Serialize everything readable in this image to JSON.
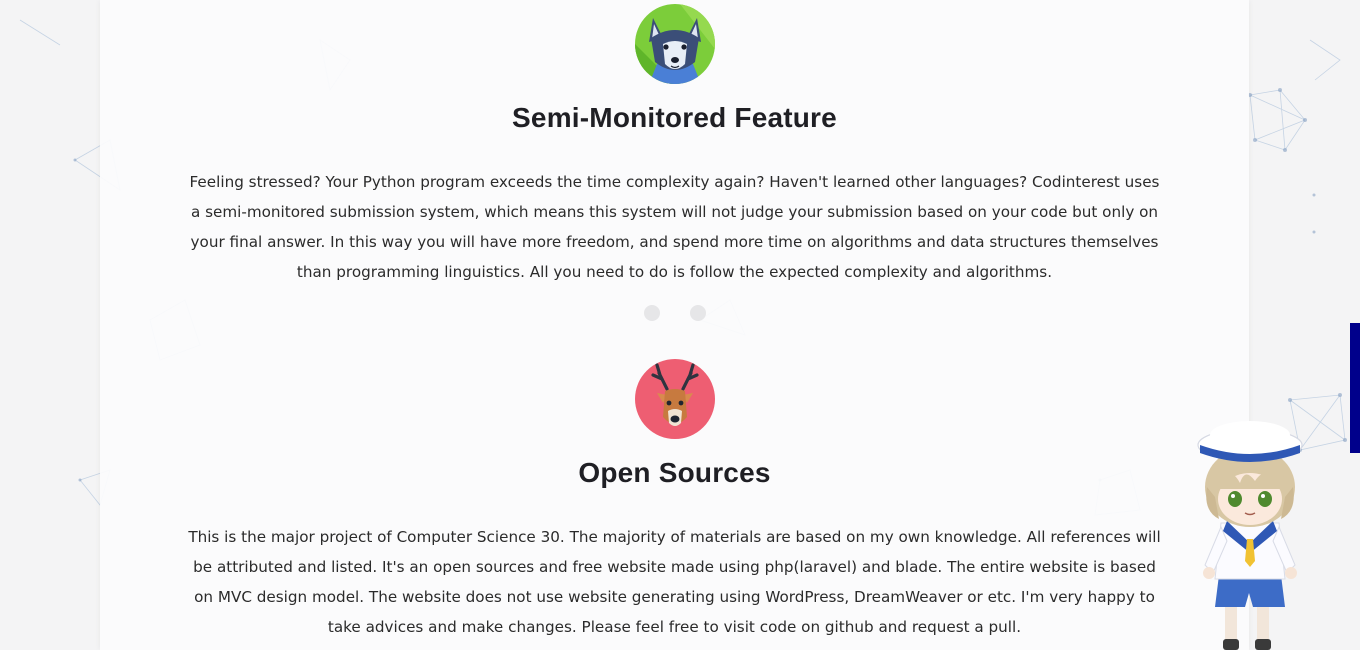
{
  "features": [
    {
      "title": "Semi-Monitored Feature",
      "icon": "husky-icon",
      "icon_bg": "#7ccd3a",
      "text": "Feeling stressed? Your Python program exceeds the time complexity again? Haven't learned other languages? Codinterest uses a semi-monitored submission system, which means this system will not judge your submission based on your code but only on your final answer. In this way you will have more freedom, and spend more time on algorithms and data structures themselves than programming linguistics. All you need to do is follow the expected complexity and algorithms."
    },
    {
      "title": "Open Sources",
      "icon": "deer-icon",
      "icon_bg": "#ee5e72",
      "text": "This is the major project of Computer Science 30. The majority of materials are based on my own knowledge. All references will be attributed and listed. It's an open sources and free website made using php(laravel) and blade. The entire website is based on MVC design model. The website does not use website generating using WordPress, DreamWeaver or etc. I'm very happy to take advices and make changes. Please feel free to visit code on github and request a pull."
    }
  ],
  "colors": {
    "side_tab": "#00008b",
    "card_bg": "#fbfbfc",
    "page_bg": "#f4f4f5"
  }
}
